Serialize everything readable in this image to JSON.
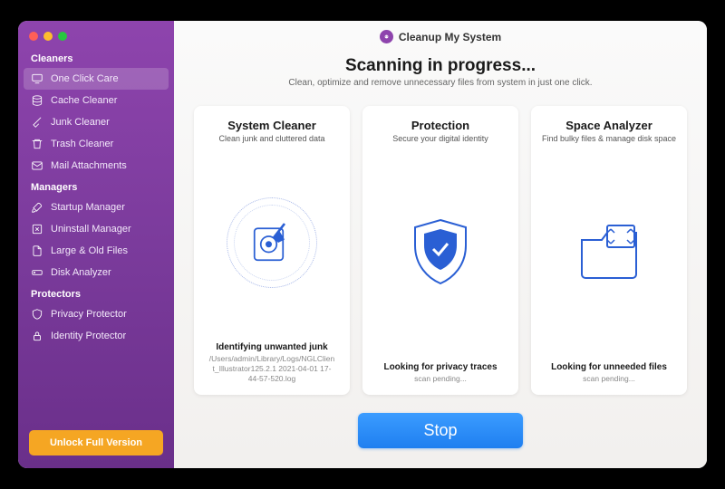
{
  "app": {
    "title": "Cleanup My System"
  },
  "sidebar": {
    "sections": [
      {
        "title": "Cleaners",
        "items": [
          {
            "label": "One Click Care",
            "active": true
          },
          {
            "label": "Cache Cleaner"
          },
          {
            "label": "Junk Cleaner"
          },
          {
            "label": "Trash Cleaner"
          },
          {
            "label": "Mail Attachments"
          }
        ]
      },
      {
        "title": "Managers",
        "items": [
          {
            "label": "Startup Manager"
          },
          {
            "label": "Uninstall Manager"
          },
          {
            "label": "Large & Old Files"
          },
          {
            "label": "Disk Analyzer"
          }
        ]
      },
      {
        "title": "Protectors",
        "items": [
          {
            "label": "Privacy Protector"
          },
          {
            "label": "Identity Protector"
          }
        ]
      }
    ],
    "unlock": "Unlock Full Version"
  },
  "headline": {
    "title": "Scanning in progress...",
    "subtitle": "Clean, optimize and remove unnecessary files from system in just one click."
  },
  "cards": [
    {
      "title": "System Cleaner",
      "subtitle": "Clean junk and cluttered data",
      "status": "Identifying unwanted junk",
      "detail": "/Users/admin/Library/Logs/NGLClient_Illustrator125.2.1 2021-04-01 17-44-57-520.log"
    },
    {
      "title": "Protection",
      "subtitle": "Secure your digital identity",
      "status": "Looking for privacy traces",
      "detail": "scan pending..."
    },
    {
      "title": "Space Analyzer",
      "subtitle": "Find bulky files & manage disk space",
      "status": "Looking for unneeded files",
      "detail": "scan pending..."
    }
  ],
  "footer": {
    "stop": "Stop"
  }
}
